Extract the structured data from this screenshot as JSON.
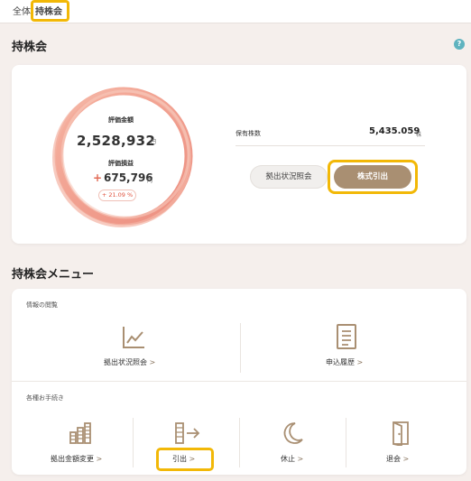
{
  "tabs": [
    {
      "label": "全体"
    },
    {
      "label": "持株会"
    }
  ],
  "page_title": "持株会",
  "help_label": "?",
  "summary": {
    "valuation_label": "評価金額",
    "valuation_value": "2,528,932",
    "yen": "円",
    "gain_label": "評価損益",
    "gain_sign": "+",
    "gain_value": "675,796",
    "gain_pct": "+ 21.09 %",
    "shares_label": "保有株数",
    "shares_value": "5,435.059",
    "shares_unit": "株",
    "btn_contribution_status": "拠出状況照会",
    "btn_withdraw_shares": "株式引出"
  },
  "menu": {
    "title": "持株会メニュー",
    "info_group_label": "情報の閲覧",
    "procedures_group_label": "各種お手続き",
    "info_items": [
      {
        "label": "拠出状況照会",
        "icon": "line-chart-icon"
      },
      {
        "label": "申込履歴",
        "icon": "document-icon"
      }
    ],
    "procedure_items": [
      {
        "label": "拠出金額変更",
        "icon": "coin-stack-icon"
      },
      {
        "label": "引出",
        "icon": "coin-withdraw-icon"
      },
      {
        "label": "休止",
        "icon": "moon-icon"
      },
      {
        "label": "退会",
        "icon": "door-exit-icon"
      }
    ],
    "chevron": ">"
  },
  "colors": {
    "accent": "#a98f72",
    "highlight": "#f2b807",
    "ring": "#ee8e7b",
    "gain": "#e26b56"
  }
}
